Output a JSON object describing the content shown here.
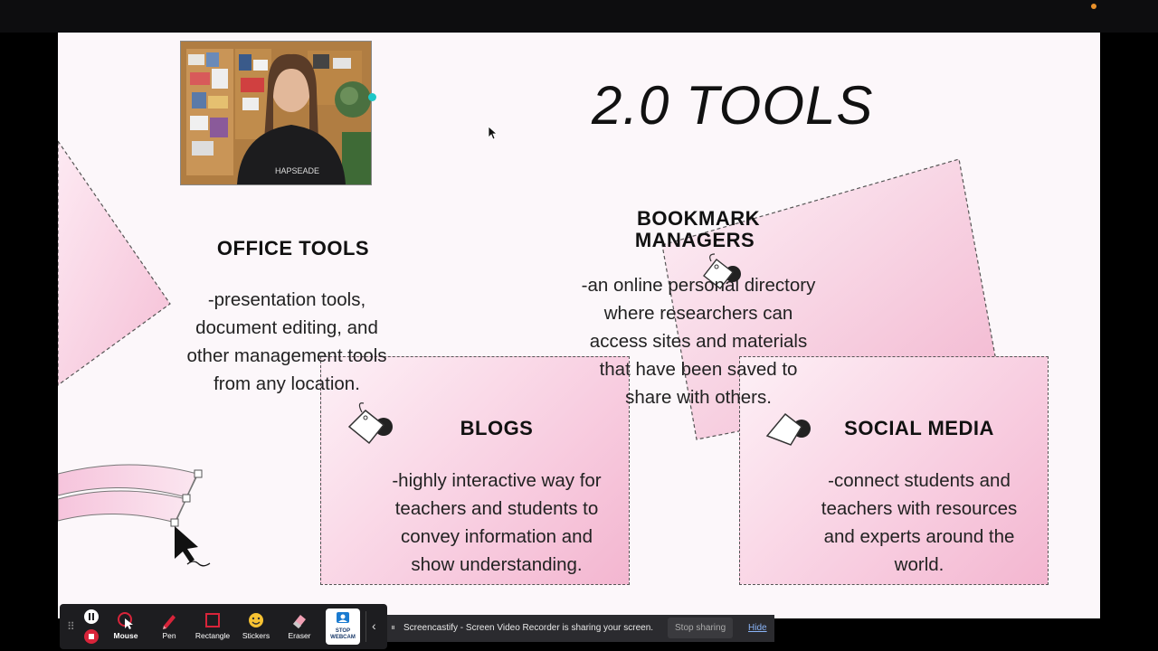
{
  "slide": {
    "title": "2.0 TOOLS",
    "office": {
      "heading": "OFFICE TOOLS",
      "lines": [
        "-presentation tools,",
        "document editing, and",
        "other management tools",
        "from any location."
      ]
    },
    "bookmark": {
      "heading_line1": "BOOKMARK",
      "heading_line2": "MANAGERS",
      "lines": [
        "-an online personal directory",
        "where researchers can",
        "access sites and materials",
        "that have been saved to",
        "share with others."
      ]
    },
    "blogs": {
      "heading": "BLOGS",
      "lines": [
        "-highly interactive way for",
        "teachers and students to",
        "convey information and",
        "show understanding."
      ]
    },
    "social": {
      "heading": "SOCIAL MEDIA",
      "lines": [
        "-connect students and",
        "teachers with resources",
        "and experts around the",
        "world."
      ]
    }
  },
  "webcam": {
    "shirt_text": "HAPSEADE"
  },
  "toolbar": {
    "mouse": "Mouse",
    "pen": "Pen",
    "rectangle": "Rectangle",
    "stickers": "Stickers",
    "eraser": "Eraser",
    "stop_webcam_1": "STOP",
    "stop_webcam_2": "WEBCAM"
  },
  "sharebar": {
    "message": "Screencastify - Screen Video Recorder is sharing your screen.",
    "stop": "Stop sharing",
    "hide": "Hide"
  },
  "colors": {
    "accent_pink": "#f3b6d0",
    "toolbar_active": "#d8243a"
  }
}
